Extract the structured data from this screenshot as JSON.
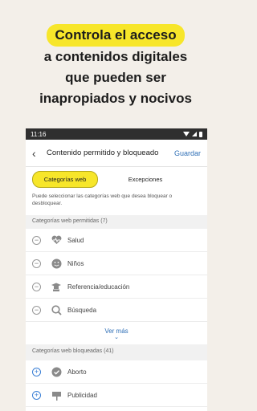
{
  "hero": {
    "line1": "Controla el acceso",
    "line2": "a contenidos digitales",
    "line3": "que pueden ser",
    "line4": "inapropiados y nocivos"
  },
  "status": {
    "time": "11:16"
  },
  "appbar": {
    "title": "Contenido permitido y bloqueado",
    "save": "Guardar"
  },
  "tabs": [
    {
      "label": "Categorías web"
    },
    {
      "label": "Excepciones"
    }
  ],
  "description": "Puede seleccionar las categorías web que desea bloquear o desbloquear.",
  "allowed": {
    "header": "Categorías web permitidas (7)",
    "items": [
      {
        "label": "Salud",
        "icon": "heart-pulse-icon"
      },
      {
        "label": "Niños",
        "icon": "smiley-face-icon"
      },
      {
        "label": "Referencia/educación",
        "icon": "graduation-cap-icon"
      },
      {
        "label": "Búsqueda",
        "icon": "magnifier-icon"
      }
    ],
    "more": "Ver más"
  },
  "blocked": {
    "header": "Categorías web bloqueadas (41)",
    "items": [
      {
        "label": "Aborto",
        "icon": "check-badge-icon"
      },
      {
        "label": "Publicidad",
        "icon": "signpost-icon"
      }
    ]
  },
  "colors": {
    "accent": "#f7e62a",
    "link": "#2f6fb6",
    "plus": "#3a7fd5"
  }
}
